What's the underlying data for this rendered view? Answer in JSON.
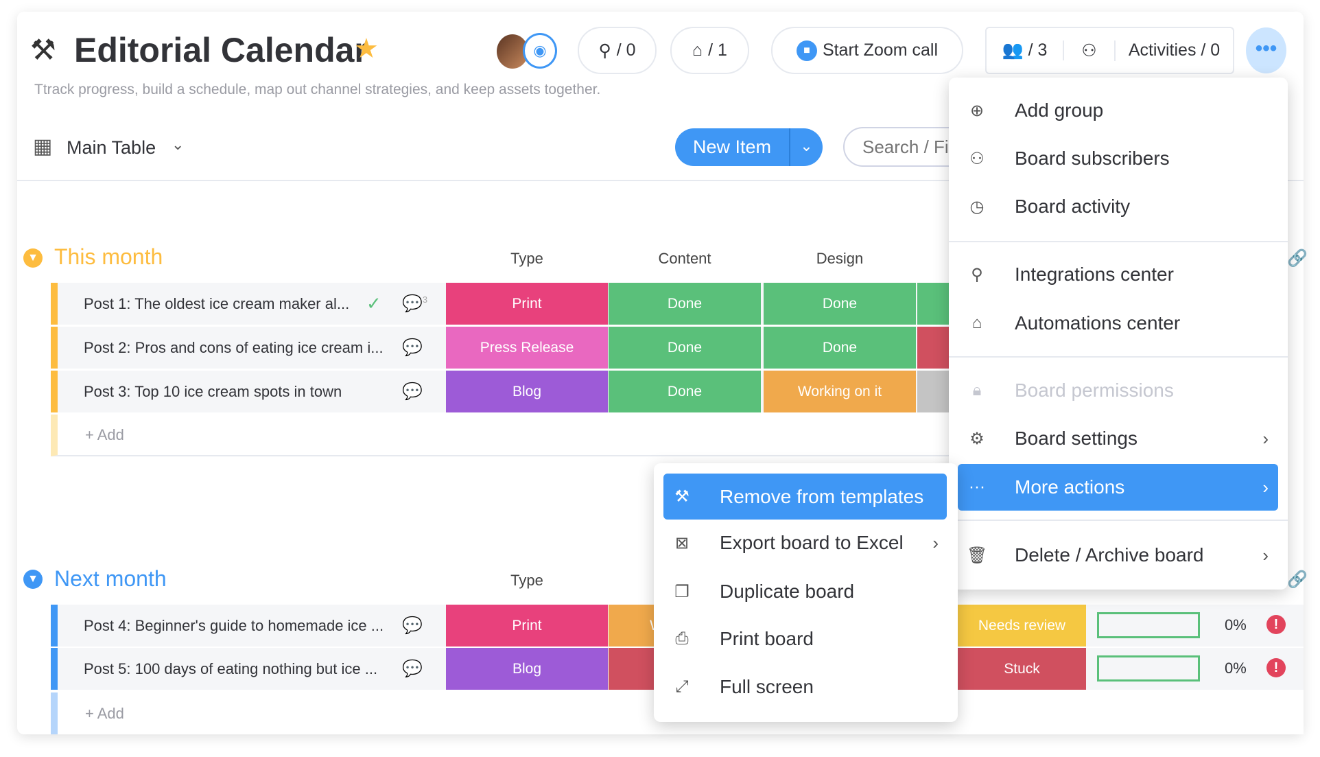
{
  "header": {
    "title": "Editorial Calendar",
    "subtitle": "Ttrack progress, build a schedule, map out channel strategies, and keep assets together.",
    "integrations_count": "/ 0",
    "automations_count": "/ 1",
    "zoom_label": "Start Zoom call",
    "members_count": "/ 3",
    "activities_label": "Activities / 0"
  },
  "toolbar": {
    "view_label": "Main Table",
    "new_item_label": "New Item",
    "search_placeholder": "Search / Fi"
  },
  "groups": [
    {
      "title": "This month",
      "color": "#fdbc3f",
      "columns": [
        "Type",
        "Content",
        "Design"
      ],
      "rows": [
        {
          "name": "Post 1: The oldest ice cream maker al...",
          "type": "Print",
          "type_color": "#e8417c",
          "content": "Done",
          "design": "Done",
          "extra_color": "#5ac07a",
          "comments": "3"
        },
        {
          "name": "Post 2: Pros and cons of eating ice cream i...",
          "type": "Press Release",
          "type_color": "#e968c0",
          "content": "Done",
          "design": "Done",
          "extra_color": "#d0505f"
        },
        {
          "name": "Post 3: Top 10 ice cream spots in town",
          "type": "Blog",
          "type_color": "#9d5bd7",
          "content": "Done",
          "design": "Working on it",
          "design_color": "#f0a94c",
          "extra_color": "#c4c4c4"
        }
      ],
      "add_label": "+ Add"
    },
    {
      "title": "Next month",
      "color": "#3f97f5",
      "columns": [
        "Type"
      ],
      "rows": [
        {
          "name": "Post 4: Beginner's guide to homemade ice ...",
          "type": "Print",
          "type_color": "#e8417c",
          "content_partial": "W",
          "content_color": "#f0a94c",
          "status": "Needs review",
          "status_color": "#f5c842",
          "progress": "0%"
        },
        {
          "name": "Post 5: 100 days of eating nothing but ice ...",
          "type": "Blog",
          "type_color": "#9d5bd7",
          "content_color": "#d0505f",
          "status": "Stuck",
          "status_color": "#d0505f",
          "progress": "0%"
        }
      ],
      "add_label": "+ Add"
    }
  ],
  "menu": {
    "items": [
      "Add group",
      "Board subscribers",
      "Board activity",
      "Integrations center",
      "Automations center",
      "Board permissions",
      "Board settings",
      "More actions",
      "Delete / Archive board"
    ]
  },
  "submenu": {
    "items": [
      "Remove from templates",
      "Export board to Excel",
      "Duplicate board",
      "Print board",
      "Full screen"
    ]
  },
  "colors": {
    "accent": "#3f97f5",
    "done": "#5ac07a"
  }
}
